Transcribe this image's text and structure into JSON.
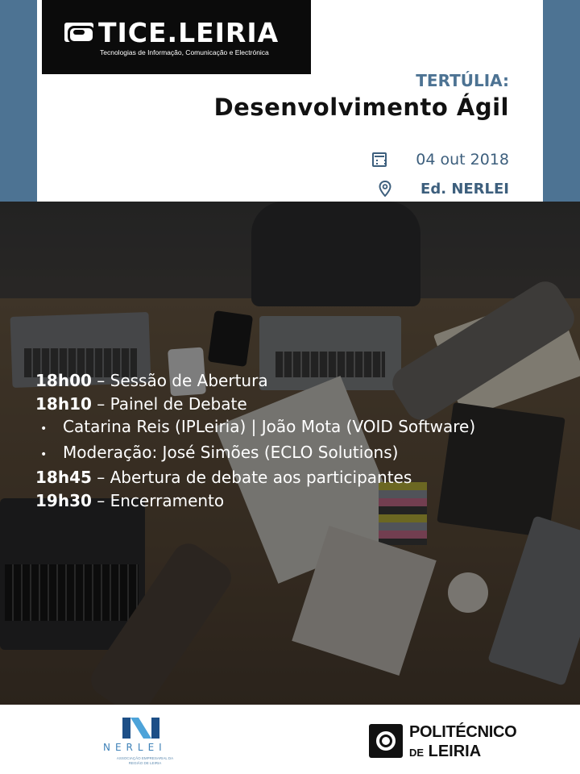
{
  "header": {
    "logo_name": "TICE.LEIRIA",
    "logo_subtitle": "Tecnologias de Informação, Comunicação e Electrónica",
    "kicker": "TERTÚLIA:",
    "title": "Desenvolvimento Ágil",
    "date": "04 out 2018",
    "location": "Ed. NERLEI",
    "colors": {
      "accent": "#4d7393",
      "info_text": "#3d5f7d",
      "logo_bg": "#0b0b0b"
    }
  },
  "icons": {
    "date": "calendar-icon",
    "location": "map-pin-icon"
  },
  "schedule": [
    {
      "time": "18h00",
      "text": " – Sessão de Abertura"
    },
    {
      "time": "18h10",
      "text": " – Painel de Debate"
    },
    {
      "bullet": "•",
      "text": "Catarina Reis (IPLeiria) | João Mota (VOID Software)"
    },
    {
      "bullet": "•",
      "text": "Moderação: José Simões (ECLO Solutions)"
    },
    {
      "time": "18h45",
      "text": " – Abertura de debate aos participantes"
    },
    {
      "time": "19h30",
      "text": " – Encerramento"
    }
  ],
  "footer": {
    "nerlei": {
      "name": "NERLEI",
      "subtitle": "ASSOCIAÇÃO EMPRESARIAL DA REGIÃO DE LEIRIA",
      "color": "#3f82b8"
    },
    "politecnico": {
      "line1": "POLITÉCNICO",
      "line2_prefix": "DE",
      "line2_main": "LEIRIA"
    }
  }
}
